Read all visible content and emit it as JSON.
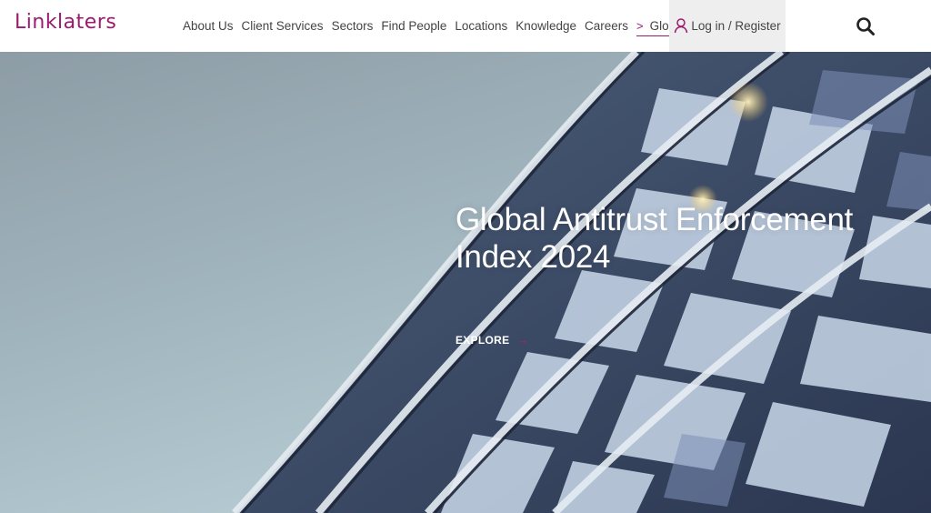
{
  "brand": {
    "logo_text": "Linklaters",
    "color": "#9b1c6e"
  },
  "nav": {
    "items": [
      "About Us",
      "Client Services",
      "Sectors",
      "Find People",
      "Locations",
      "Knowledge",
      "Careers"
    ],
    "global": {
      "chevron": ">",
      "label": "Global"
    }
  },
  "account": {
    "label": "Log in / Register",
    "icon": "user-icon"
  },
  "search": {
    "icon": "search-icon"
  },
  "hero": {
    "title_line1": "Global Antitrust Enforcement",
    "title_line2": "Index 2024",
    "cta_label": "EXPLORE",
    "cta_arrow": "→"
  }
}
